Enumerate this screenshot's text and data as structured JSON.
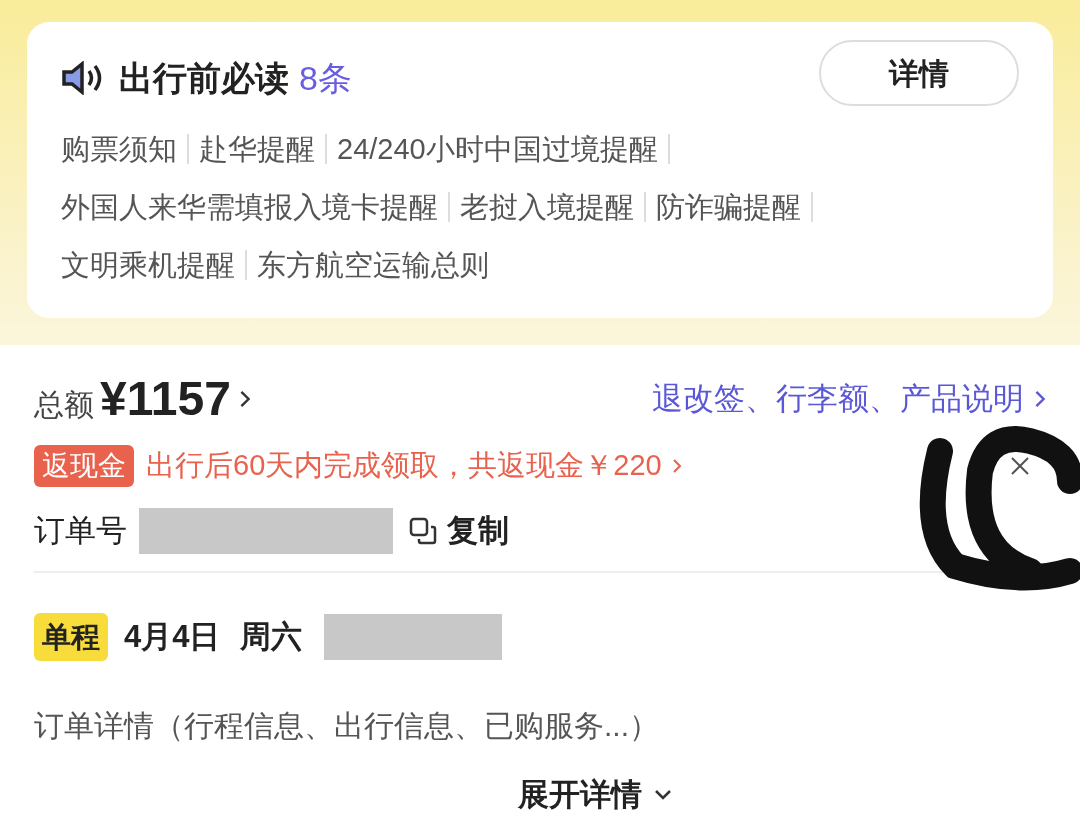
{
  "notice": {
    "title": "出行前必读",
    "count": "8条",
    "button": "详情",
    "links": [
      "购票须知",
      "赴华提醒",
      "24/240小时中国过境提醒",
      "外国人来华需填报入境卡提醒",
      "老挝入境提醒",
      "防诈骗提醒",
      "文明乘机提醒",
      "东方航空运输总则"
    ]
  },
  "order": {
    "total_label": "总额",
    "total": "¥1157",
    "policy_link": "退改签、行李额、产品说明",
    "cashback_tag": "返现金",
    "cashback_text": "出行后60天内完成领取，共返现金￥220",
    "order_no_label": "订单号",
    "copy": "复制"
  },
  "trip": {
    "tag": "单程",
    "date": "4月4日",
    "weekday": "周六",
    "details": "订单详情（行程信息、出行信息、已购服务...）",
    "expand": "展开详情"
  }
}
